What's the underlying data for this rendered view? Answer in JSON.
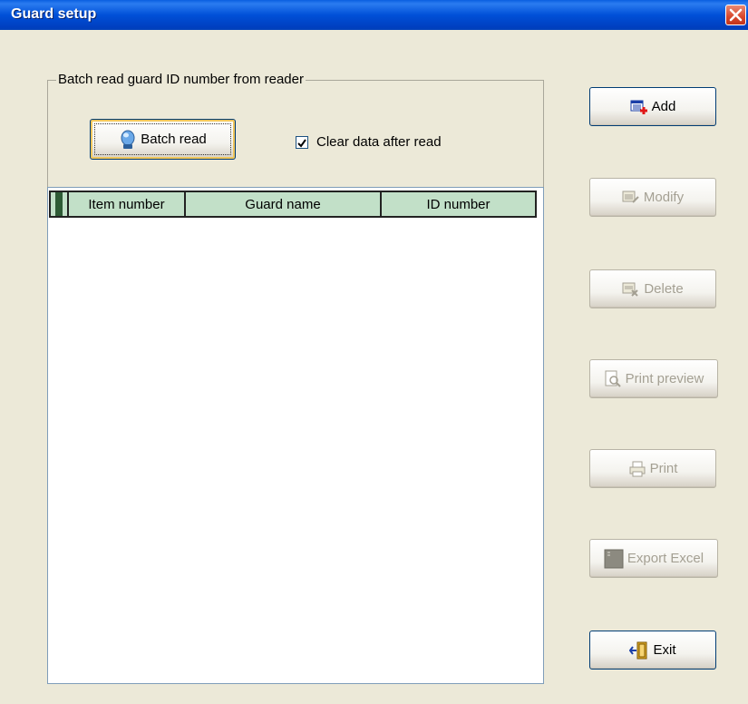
{
  "window": {
    "title": "Guard setup"
  },
  "group": {
    "legend": "Batch read guard ID number from reader",
    "batch_read_label": "Batch read",
    "clear_after_read": {
      "label": "Clear data after read",
      "checked": true
    }
  },
  "grid": {
    "columns": [
      "Item number",
      "Guard name",
      "ID number"
    ],
    "rows": []
  },
  "side_buttons": {
    "add": "Add",
    "modify": "Modify",
    "delete": "Delete",
    "print_preview": "Print preview",
    "print": "Print",
    "export_excel": "Export Excel",
    "exit": "Exit"
  },
  "colors": {
    "titlebar": "#0050d8",
    "header_bg": "#c2e0c8",
    "window_bg": "#ece9d8"
  }
}
